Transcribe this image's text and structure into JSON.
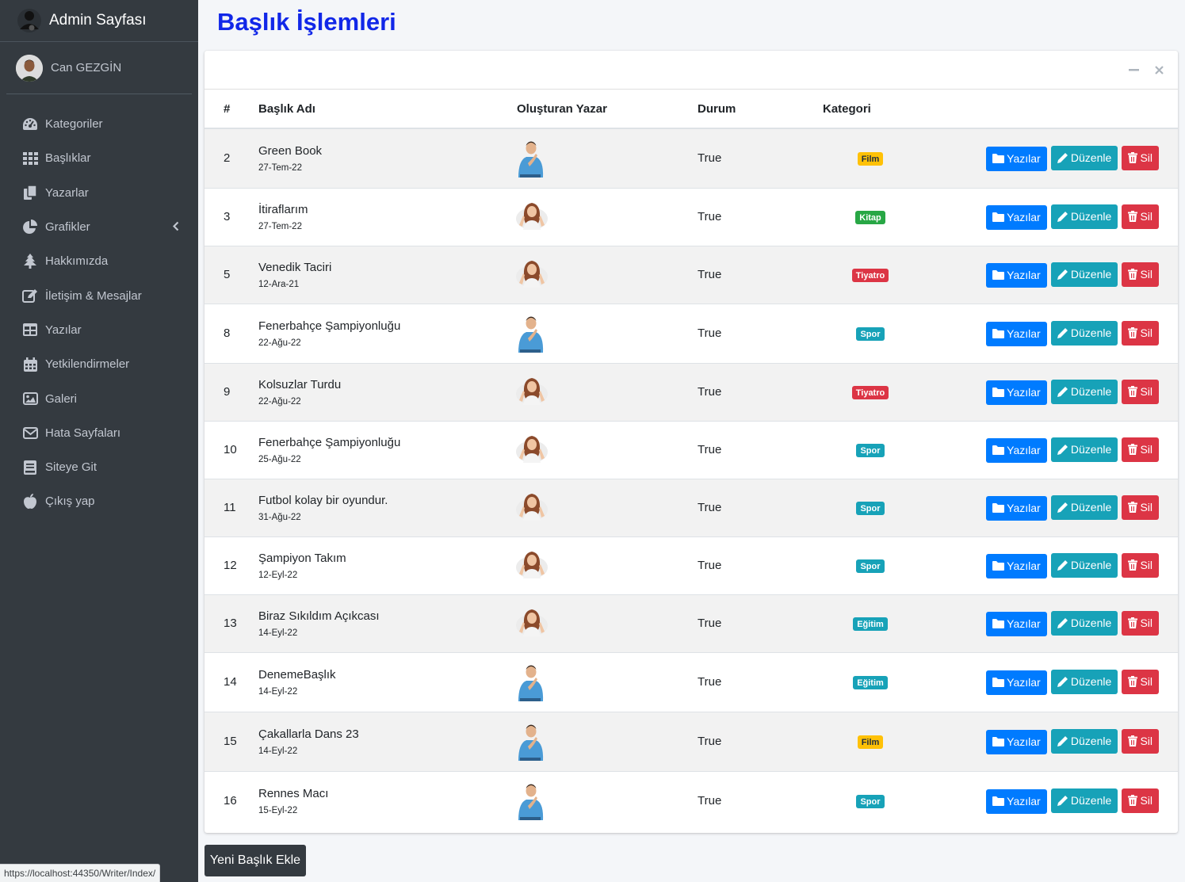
{
  "brand": {
    "title": "Admin Sayfası"
  },
  "user": {
    "name": "Can GEZGİN"
  },
  "sidebar": {
    "items": [
      {
        "label": "Kategoriler",
        "icon": "tachometer-icon"
      },
      {
        "label": "Başlıklar",
        "icon": "grid-icon"
      },
      {
        "label": "Yazarlar",
        "icon": "copy-icon"
      },
      {
        "label": "Grafikler",
        "icon": "pie-chart-icon"
      },
      {
        "label": "Hakkımızda",
        "icon": "tree-icon"
      },
      {
        "label": "İletişim & Mesajlar",
        "icon": "edit-icon"
      },
      {
        "label": "Yazılar",
        "icon": "table-icon"
      },
      {
        "label": "Yetkilendirmeler",
        "icon": "calendar-icon"
      },
      {
        "label": "Galeri",
        "icon": "image-icon"
      },
      {
        "label": "Hata Sayfaları",
        "icon": "envelope-icon"
      },
      {
        "label": "Siteye Git",
        "icon": "book-icon"
      },
      {
        "label": "Çıkış yap",
        "icon": "apple-icon"
      }
    ]
  },
  "page": {
    "title": "Başlık İşlemleri"
  },
  "table": {
    "headers": {
      "id": "#",
      "name": "Başlık Adı",
      "author": "Oluşturan Yazar",
      "status": "Durum",
      "category": "Kategori"
    },
    "rows": [
      {
        "id": "2",
        "name": "Green Book",
        "date": "27-Tem-22",
        "author": "male",
        "status": "True",
        "category": "Film",
        "cat_color": "#ffc107",
        "cat_text": "#1f2d3d"
      },
      {
        "id": "3",
        "name": "İtiraflarım",
        "date": "27-Tem-22",
        "author": "female",
        "status": "True",
        "category": "Kitap",
        "cat_color": "#28a745",
        "cat_text": "#ffffff"
      },
      {
        "id": "5",
        "name": "Venedik Taciri",
        "date": "12-Ara-21",
        "author": "female",
        "status": "True",
        "category": "Tiyatro",
        "cat_color": "#dc3545",
        "cat_text": "#ffffff"
      },
      {
        "id": "8",
        "name": "Fenerbahçe Şampiyonluğu",
        "date": "22-Ağu-22",
        "author": "male",
        "status": "True",
        "category": "Spor",
        "cat_color": "#17a2b8",
        "cat_text": "#ffffff"
      },
      {
        "id": "9",
        "name": "Kolsuzlar Turdu",
        "date": "22-Ağu-22",
        "author": "female",
        "status": "True",
        "category": "Tiyatro",
        "cat_color": "#dc3545",
        "cat_text": "#ffffff"
      },
      {
        "id": "10",
        "name": "Fenerbahçe Şampiyonluğu",
        "date": "25-Ağu-22",
        "author": "female",
        "status": "True",
        "category": "Spor",
        "cat_color": "#17a2b8",
        "cat_text": "#ffffff"
      },
      {
        "id": "11",
        "name": "Futbol kolay bir oyundur.",
        "date": "31-Ağu-22",
        "author": "female",
        "status": "True",
        "category": "Spor",
        "cat_color": "#17a2b8",
        "cat_text": "#ffffff"
      },
      {
        "id": "12",
        "name": "Şampiyon Takım",
        "date": "12-Eyl-22",
        "author": "female",
        "status": "True",
        "category": "Spor",
        "cat_color": "#17a2b8",
        "cat_text": "#ffffff"
      },
      {
        "id": "13",
        "name": "Biraz Sıkıldım Açıkcası",
        "date": "14-Eyl-22",
        "author": "female",
        "status": "True",
        "category": "Eğitim",
        "cat_color": "#17a2b8",
        "cat_text": "#ffffff"
      },
      {
        "id": "14",
        "name": "DenemeBaşlık",
        "date": "14-Eyl-22",
        "author": "male",
        "status": "True",
        "category": "Eğitim",
        "cat_color": "#17a2b8",
        "cat_text": "#ffffff"
      },
      {
        "id": "15",
        "name": "Çakallarla Dans 23",
        "date": "14-Eyl-22",
        "author": "male",
        "status": "True",
        "category": "Film",
        "cat_color": "#ffc107",
        "cat_text": "#1f2d3d"
      },
      {
        "id": "16",
        "name": "Rennes Macı",
        "date": "15-Eyl-22",
        "author": "male",
        "status": "True",
        "category": "Spor",
        "cat_color": "#17a2b8",
        "cat_text": "#ffffff"
      }
    ],
    "actions": {
      "posts": "Yazılar",
      "edit": "Düzenle",
      "delete": "Sil"
    }
  },
  "footer": {
    "add_button": "Yeni Başlık Ekle"
  },
  "browser": {
    "status_url": "https://localhost:44350/Writer/Index/"
  },
  "colors": {
    "sidebar": "#343a40",
    "title": "#1127e8",
    "primary": "#007bff",
    "info": "#17a2b8",
    "danger": "#dc3545"
  }
}
